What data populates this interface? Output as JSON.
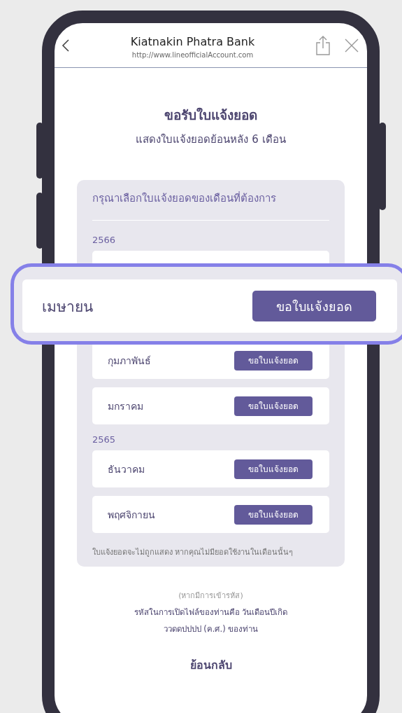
{
  "browser": {
    "title": "Kiatnakin Phatra Bank",
    "url": "http://www.lineofficialAccount.com"
  },
  "heading": "ขอรับใบแจ้งยอด",
  "subheading": "แสดงใบแจ้งยอดย้อนหลัง 6 เดือน",
  "panel": {
    "title": "กรุณาเลือกใบแจ้งยอดของเดือนที่ต้องการ",
    "groups": [
      {
        "year": "2566",
        "rows": [
          {},
          {},
          {
            "month": "กุมภาพันธ์",
            "button": "ขอใบแจ้งยอด"
          },
          {
            "month": "มกราคม",
            "button": "ขอใบแจ้งยอด"
          }
        ]
      },
      {
        "year": "2565",
        "rows": [
          {
            "month": "ธันวาคม",
            "button": "ขอใบแจ้งยอด"
          },
          {
            "month": "พฤศจิกายน",
            "button": "ขอใบแจ้งยอด"
          }
        ]
      }
    ],
    "note": "ใบแจ้งยอดจะไม่ถูกแสดง หากคุณไม่มียอดใช้งานในเดือนนั้นๆ"
  },
  "password_note": {
    "hint": "(หากมีการเข้ารหัส)",
    "lines": [
      "รหัสในการเปิดไฟล์ของท่านคือ วันเดือนปีเกิด",
      "ววดดปปปป (ค.ศ.) ของท่าน"
    ]
  },
  "back_link": "ย้อนกลับ",
  "callout": {
    "month": "เมษายน",
    "button": "ขอใบแจ้งยอด"
  }
}
